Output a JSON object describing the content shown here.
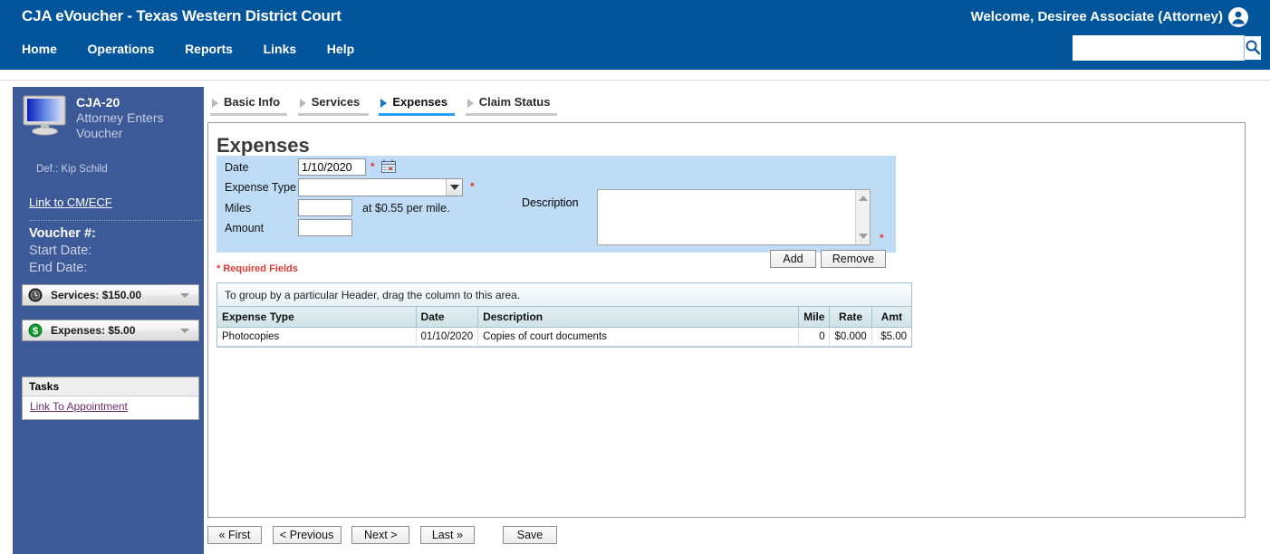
{
  "header": {
    "app_title": "CJA eVoucher - Texas Western District Court",
    "welcome": "Welcome, Desiree Associate (Attorney)",
    "user_icon": "user-account-icon",
    "nav": [
      {
        "label": "Home"
      },
      {
        "label": "Operations"
      },
      {
        "label": "Reports"
      },
      {
        "label": "Links"
      },
      {
        "label": "Help"
      }
    ],
    "search": {
      "value": "",
      "placeholder": "",
      "icon": "search-icon"
    },
    "brand_color": "#02549b"
  },
  "sidebar": {
    "doc_code": "CJA-20",
    "doc_line2": "Attorney Enters",
    "doc_line3": "Voucher",
    "defendant": "Def.: Kip Schild",
    "cmecf_link": "Link to CM/ECF",
    "voucher_no": "Voucher #:",
    "start_date": "Start Date:",
    "end_date": "End Date:",
    "accordions": [
      {
        "label": "Services: $150.00",
        "icon": "clock-icon"
      },
      {
        "label": "Expenses: $5.00",
        "icon": "dollar-icon"
      }
    ],
    "tasks_title": "Tasks",
    "tasks_link": "Link To Appointment",
    "bg_color": "#3d5a98"
  },
  "tabs": [
    {
      "label": "Basic Info",
      "active": false
    },
    {
      "label": "Services",
      "active": false
    },
    {
      "label": "Expenses",
      "active": true
    },
    {
      "label": "Claim Status",
      "active": false
    }
  ],
  "main": {
    "title": "Expenses",
    "form": {
      "date_label": "Date",
      "date_value": "1/10/2020",
      "date_required": "*",
      "calendar_icon": "calendar-icon",
      "expense_type_label": "Expense Type",
      "expense_type_value": "",
      "expense_type_required": "*",
      "miles_label": "Miles",
      "miles_value": "",
      "mileage_note": "at $0.55 per mile.",
      "amount_label": "Amount",
      "amount_value": "",
      "description_label": "Description",
      "description_value": "",
      "description_required": "*",
      "add_label": "Add",
      "remove_label": "Remove"
    },
    "required_note": "* Required Fields",
    "grid": {
      "group_hint": "To group by a particular Header, drag the column to this area.",
      "columns": [
        "Expense Type",
        "Date",
        "Description",
        "Mile",
        "Rate",
        "Amt"
      ],
      "rows": [
        {
          "expense_type": "Photocopies",
          "date": "01/10/2020",
          "description": "Copies of court documents",
          "mile": "0",
          "rate": "$0.000",
          "amt": "$5.00"
        }
      ]
    }
  },
  "footer": {
    "first": "« First",
    "previous": "< Previous",
    "next": "Next >",
    "last": "Last »",
    "save": "Save"
  }
}
